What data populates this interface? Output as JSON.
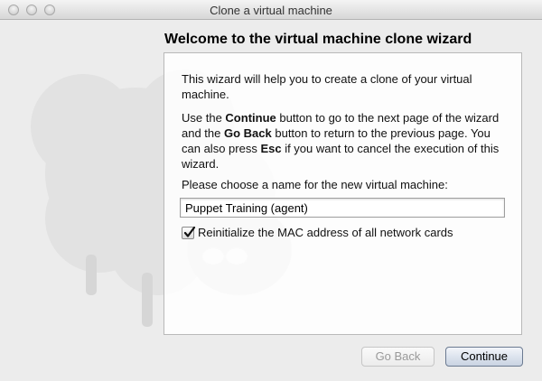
{
  "window": {
    "title": "Clone a virtual machine"
  },
  "wizard": {
    "heading": "Welcome to the virtual machine clone wizard",
    "intro": "This wizard will help you to create a clone of your virtual machine.",
    "instructions": {
      "part1": "Use the ",
      "continue_word": "Continue",
      "part2": " button to go to the next page of the wizard and the ",
      "goback_word": "Go Back",
      "part3": " button to return to the previous page. You can also press ",
      "esc_word": "Esc",
      "part4": " if you want to cancel the execution of this wizard."
    },
    "name_prompt": "Please choose a name for the new virtual machine:",
    "name_value": "Puppet Training (agent)",
    "reinit_mac_label": "Reinitialize the MAC address of all network cards",
    "reinit_mac_checked": true
  },
  "buttons": {
    "go_back": "Go Back",
    "continue": "Continue",
    "go_back_enabled": false
  },
  "icons": {
    "background": "sheep-mascot-icon",
    "checkmark": "checkmark-icon"
  }
}
